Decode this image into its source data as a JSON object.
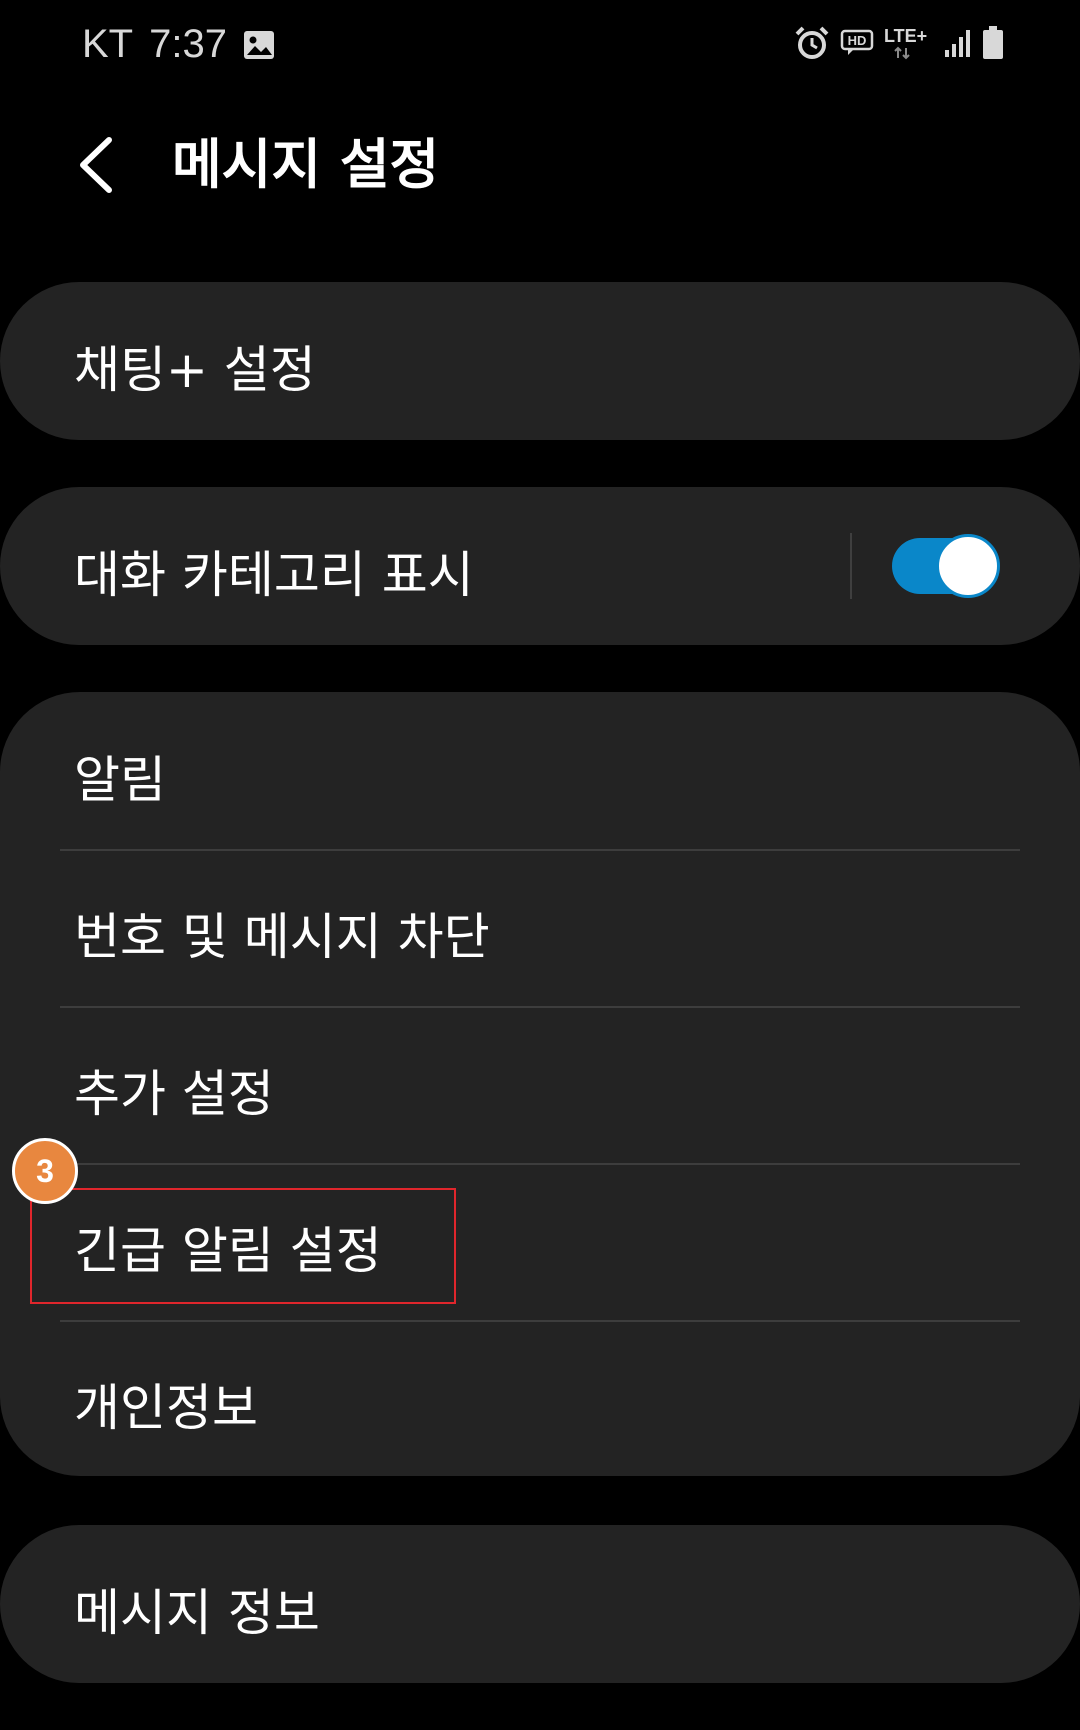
{
  "status_bar": {
    "carrier": "KT",
    "time": "7:37",
    "network": "LTE+",
    "hd_label": "HD",
    "icons": [
      "image-icon",
      "alarm-icon",
      "hd-voice-icon",
      "lte-icon",
      "signal-icon",
      "battery-icon"
    ]
  },
  "header": {
    "title": "메시지 설정",
    "back_icon": "chevron-left-icon"
  },
  "settings": {
    "chat_plus": {
      "label": "채팅+ 설정"
    },
    "conversation_categories": {
      "label": "대화 카테고리 표시",
      "toggle_on": true
    },
    "group": [
      {
        "label": "알림"
      },
      {
        "label": "번호 및 메시지 차단"
      },
      {
        "label": "추가 설정"
      },
      {
        "label": "긴급 알림 설정"
      },
      {
        "label": "개인정보"
      }
    ],
    "about": {
      "label": "메시지 정보"
    }
  },
  "annotation": {
    "step": "3",
    "badge_color": "#e8873f",
    "box_color": "#e0262c"
  },
  "colors": {
    "background": "#000000",
    "card": "#232323",
    "accent": "#0a87c9"
  }
}
